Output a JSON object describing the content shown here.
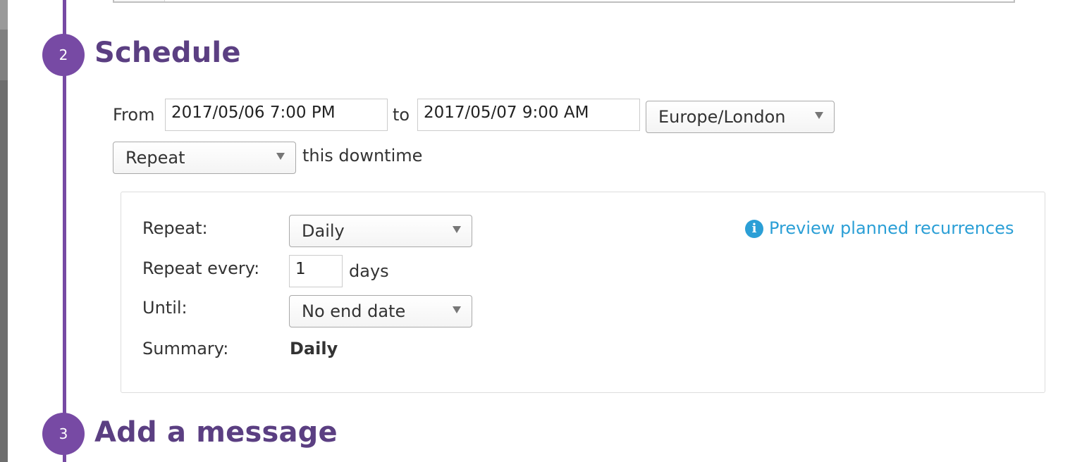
{
  "steps": [
    {
      "number": "2",
      "title": "Schedule"
    },
    {
      "number": "3",
      "title": "Add a message"
    }
  ],
  "schedule": {
    "from_label": "From",
    "from_value": "2017/05/06 7:00 PM",
    "to_label": "to",
    "to_value": "2017/05/07 9:00 AM",
    "timezone": "Europe/London",
    "repeat_select": "Repeat",
    "repeat_suffix": "this downtime"
  },
  "recurrence": {
    "repeat_label": "Repeat:",
    "repeat_value": "Daily",
    "every_label": "Repeat every:",
    "every_value": "1",
    "every_unit": "days",
    "until_label": "Until:",
    "until_value": "No end date",
    "summary_label": "Summary:",
    "summary_value": "Daily",
    "preview_link": "Preview planned recurrences",
    "preview_icon": "info-icon",
    "info_glyph": "i"
  },
  "colors": {
    "accent_purple": "#774aa4",
    "title_purple": "#5b3f82",
    "link_blue": "#2b9fd6"
  }
}
